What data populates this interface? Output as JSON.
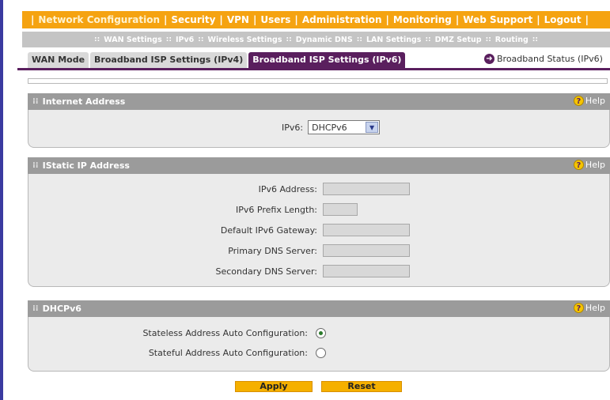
{
  "main_nav": [
    {
      "label": "Network Configuration",
      "active": true
    },
    {
      "label": "Security"
    },
    {
      "label": "VPN"
    },
    {
      "label": "Users"
    },
    {
      "label": "Administration"
    },
    {
      "label": "Monitoring"
    },
    {
      "label": "Web Support"
    },
    {
      "label": "Logout"
    }
  ],
  "sub_nav": [
    "WAN Settings",
    "IPv6",
    "Wireless Settings",
    "Dynamic DNS",
    "LAN Settings",
    "DMZ Setup",
    "Routing"
  ],
  "tabs": [
    "WAN Mode",
    "Broadband ISP Settings (IPv4)",
    "Broadband ISP Settings (IPv6)"
  ],
  "active_tab": 2,
  "status_link": "Broadband Status (IPv6)",
  "help_label": "Help",
  "internet_address": {
    "title": "Internet Address",
    "ipv6_label": "IPv6:",
    "ipv6_value": "DHCPv6"
  },
  "static_ip": {
    "title": "IStatic IP Address",
    "fields": [
      {
        "label": "IPv6 Address:"
      },
      {
        "label": "IPv6 Prefix Length:"
      },
      {
        "label": "Default IPv6 Gateway:"
      },
      {
        "label": "Primary DNS Server:"
      },
      {
        "label": "Secondary DNS Server:"
      }
    ]
  },
  "dhcpv6": {
    "title": "DHCPv6",
    "options": [
      {
        "label": "Stateless Address Auto Configuration:",
        "checked": true
      },
      {
        "label": "Stateful Address Auto Configuration:",
        "checked": false
      }
    ]
  },
  "buttons": {
    "apply": "Apply",
    "reset": "Reset"
  },
  "colors": {
    "nav_orange": "#f5a311",
    "tab_purple": "#5a1f5e",
    "button_gold": "#f5b000"
  }
}
